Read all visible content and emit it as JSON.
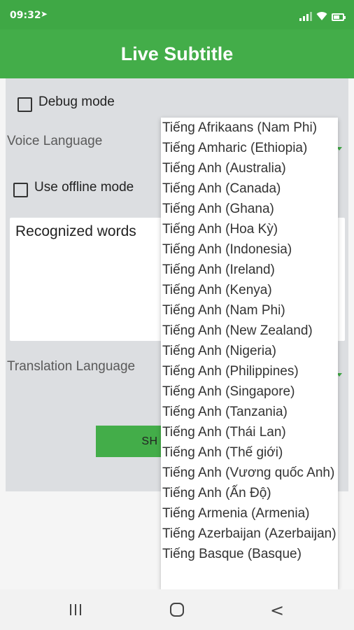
{
  "status_bar": {
    "time": "09:32",
    "nav_indicator": "➤",
    "icons": [
      "signal-icon",
      "wifi-icon",
      "battery-icon"
    ]
  },
  "app_bar": {
    "title": "Live Subtitle"
  },
  "form": {
    "debug_mode_label": "Debug mode",
    "voice_language_label": "Voice Language",
    "offline_mode_label": "Use offline mode",
    "recognized_words": "Recognized words",
    "translation_language_label": "Translation Language",
    "show_button_label": "SH"
  },
  "dropdown": {
    "items": [
      "Tiếng Afrikaans (Nam Phi)",
      "Tiếng Amharic (Ethiopia)",
      "Tiếng Anh (Australia)",
      "Tiếng Anh (Canada)",
      "Tiếng Anh (Ghana)",
      "Tiếng Anh (Hoa Kỳ)",
      "Tiếng Anh (Indonesia)",
      "Tiếng Anh (Ireland)",
      "Tiếng Anh (Kenya)",
      "Tiếng Anh (Nam Phi)",
      "Tiếng Anh (New Zealand)",
      "Tiếng Anh (Nigeria)",
      "Tiếng Anh (Philippines)",
      "Tiếng Anh (Singapore)",
      "Tiếng Anh (Tanzania)",
      "Tiếng Anh (Thái Lan)",
      "Tiếng Anh (Thế giới)",
      "Tiếng Anh (Vương quốc Anh)",
      "Tiếng Anh (Ấn Độ)",
      "Tiếng Armenia (Armenia)",
      "Tiếng Azerbaijan (Azerbaijan)",
      "Tiếng Basque (Basque)"
    ]
  },
  "nav_bar": {
    "back_glyph": "<"
  },
  "colors": {
    "primary": "#43ad49",
    "status_bar": "#3fa845",
    "content_bg": "#dcdee1"
  }
}
